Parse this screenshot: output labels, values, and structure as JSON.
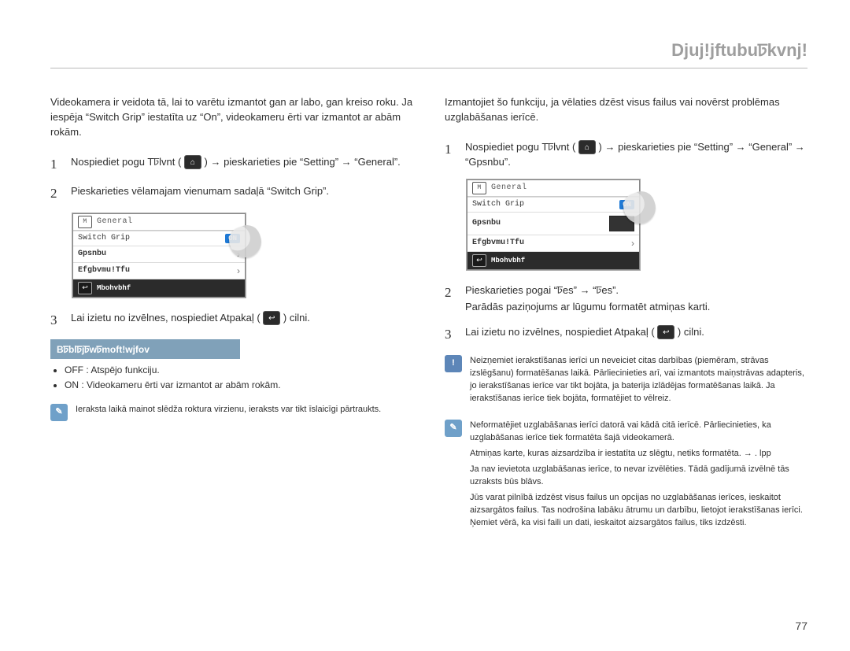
{
  "header": {
    "title": "Djuj!jftubuꠑkvnj!"
  },
  "left": {
    "intro": "Videokamera ir veidota tā, lai to varētu izmantot gan ar labo, gan kreiso roku. Ja iespēja “Switch Grip” iestatīta uz “On”, videokameru ērti var izmantot ar abām rokām.",
    "steps": [
      {
        "num": "1",
        "first": "Nospiediet pogu Tꠑlvnt ( ",
        "after_icon": " ) → pieskarieties pie “Setting” → “General”.",
        "line2": ""
      },
      {
        "num": "2",
        "first": "Pieskarieties vēlamajam vienumam sadaļā “Switch Grip”."
      },
      {
        "num": "3",
        "first": "Lai izietu no izvēlnes, nospiediet Atpakaļ ( ",
        "after_icon": " ) cilni."
      }
    ],
    "info_title": "Bꠑblꠑjꠑwꠑmoft!wjfov",
    "bullets": [
      "OFF : Atspējo funkciju.",
      "ON : Videokameru ērti var izmantot ar abām rokām."
    ],
    "note": "Ieraksta laikā mainot slēdža roktura virzienu, ieraksts var tikt īslaicīgi pārtraukts."
  },
  "right": {
    "intro": "Izmantojiet šo funkciju, ja vēlaties dzēst visus failus vai novērst problēmas uzglabāšanas ierīcē.",
    "steps": [
      {
        "num": "1",
        "first": "Nospiediet pogu Tꠑlvnt ( ",
        "after_icon": " ) → pieskarieties pie “Setting” → “General” → “Gpsnbu”."
      },
      {
        "num": "2",
        "first": "Pieskarieties pogai “ꠑes” → “ꠑes”.",
        "line2": "Parādās paziņojums ar lūgumu formatēt atmiņas karti."
      },
      {
        "num": "3",
        "first": "Lai izietu no izvēlnes, nospiediet Atpakaļ ( ",
        "after_icon": " ) cilni."
      }
    ],
    "warn": "Neizņemiet ierakstīšanas ierīci un neveiciet citas darbības (piemēram, strāvas izslēgšanu) formatēšanas laikā. Pārliecinieties arī, vai izmantots maiņstrāvas adapteris, jo ierakstīšanas ierīce var tikt bojāta, ja baterija izlādējas formatēšanas laikā. Ja ierakstīšanas ierīce tiek bojāta, formatējiet to vēlreiz.",
    "tips": [
      "Neformatējiet uzglabāšanas ierīci datorā vai kādā citā ierīcē. Pārliecinieties, ka uzglabāšanas ierīce tiek formatēta šajā videokamerā.",
      "Atmiņas karte, kuras aizsardzība ir iestatīta uz slēgtu, netiks formatēta. → . lpp",
      "Ja nav ievietota uzglabāšanas ierīce, to nevar izvēlēties. Tādā gadījumā izvēlnē tās uzraksts būs blāvs.",
      "Jūs varat pilnībā izdzēst visus failus un opcijas no uzglabāšanas ierīces, ieskaitot aizsargātos failus. Tas nodrošina labāku ātrumu un darbību, lietojot ierakstīšanas ierīci. Ņemiet vērā, ka visi faili un dati, ieskaitot aizsargātos failus, tiks izdzēsti."
    ]
  },
  "menu": {
    "head": "General",
    "rows": {
      "switch_grip": "Switch Grip",
      "on": "ON",
      "format": "Gpsnbu",
      "default": "Efgbvmu!Tfu",
      "language": "Mbohvbhf"
    }
  },
  "page_number": "77"
}
